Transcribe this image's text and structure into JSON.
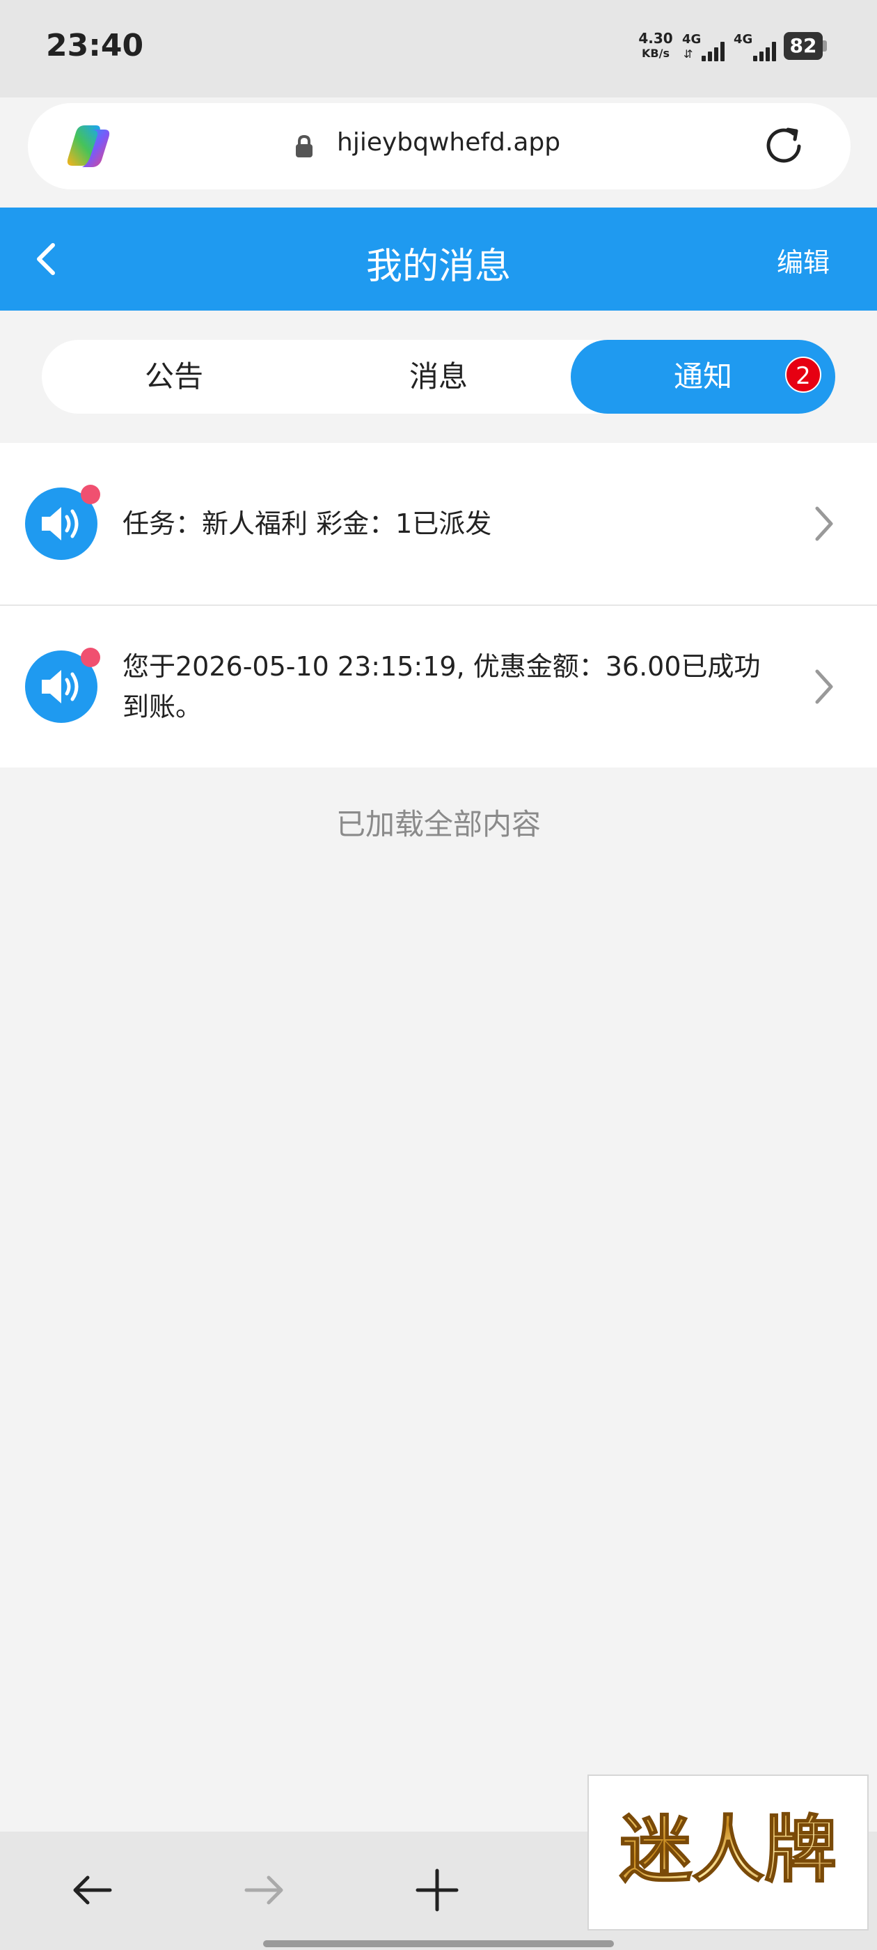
{
  "status_bar": {
    "time": "23:40",
    "net_speed_value": "4.30",
    "net_speed_unit": "KB/s",
    "sim1_label": "4G",
    "sim2_label": "4G",
    "battery": "82"
  },
  "browser": {
    "url": "hjieybqwhefd.app",
    "logo_icon": "copilot-logo-icon",
    "lock_icon": "lock-icon",
    "reload_icon": "reload-icon"
  },
  "header": {
    "title": "我的消息",
    "edit_label": "编辑",
    "back_icon": "chevron-left-icon"
  },
  "tabs": [
    {
      "label": "公告",
      "active": false
    },
    {
      "label": "消息",
      "active": false
    },
    {
      "label": "通知",
      "active": true,
      "badge": "2"
    }
  ],
  "messages": [
    {
      "text": "任务：新人福利 彩金：1已派发",
      "unread": true
    },
    {
      "text": "您于2026-05-10 23:15:19, 优惠金额：36.00已成功到账。",
      "unread": true
    }
  ],
  "loaded_text": "已加载全部内容",
  "bottom_nav": [
    "arrow-left-icon",
    "arrow-right-icon",
    "plus-icon"
  ],
  "ad": {
    "text": "迷人牌"
  },
  "colors": {
    "primary": "#1f9af0",
    "badge": "#e60012",
    "unread_dot": "#f05070",
    "background": "#f3f3f3"
  }
}
